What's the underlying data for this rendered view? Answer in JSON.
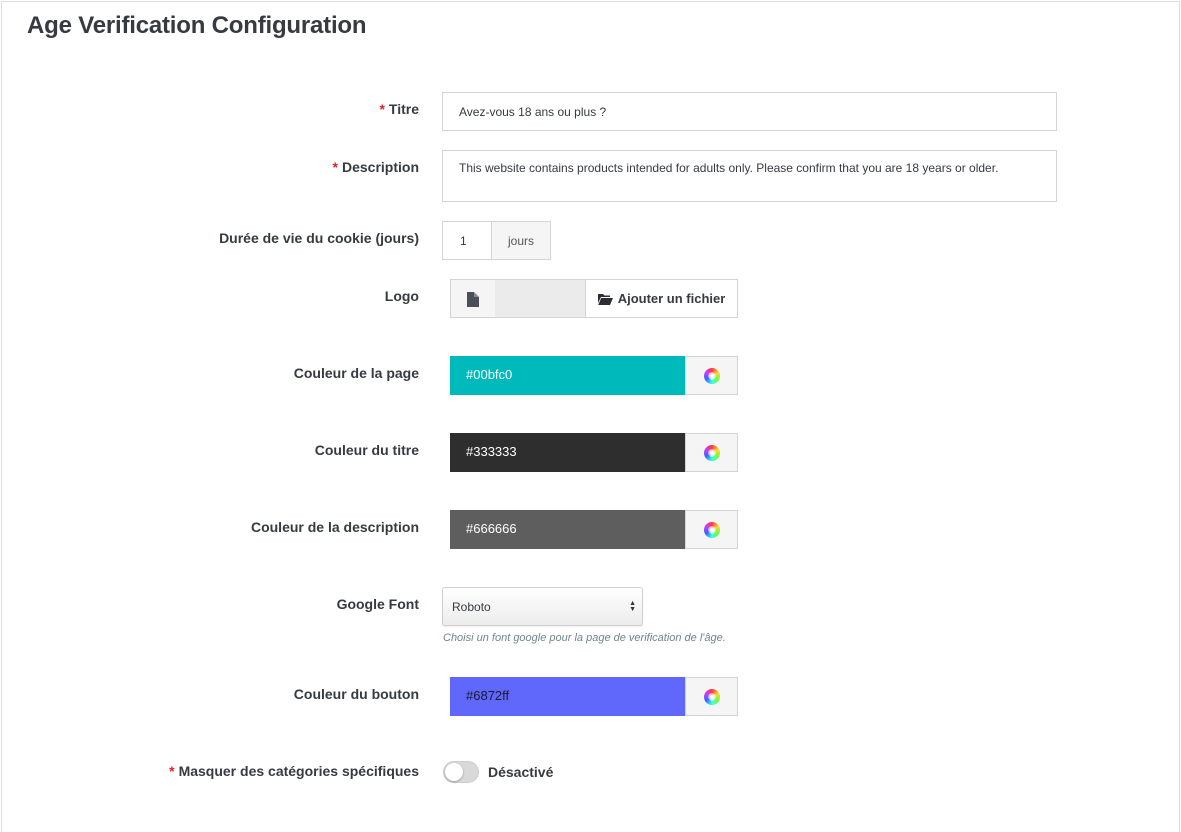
{
  "panel": {
    "title": "Age Verification Configuration"
  },
  "fields": {
    "titre": {
      "label": "Titre",
      "required": true,
      "value": "Avez-vous 18 ans ou plus ?"
    },
    "description": {
      "label": "Description",
      "required": true,
      "value": "This website contains products intended for adults only. Please confirm that you are 18 years or older."
    },
    "cookie": {
      "label": "Durée de vie du cookie (jours)",
      "value": "1",
      "suffix": "jours"
    },
    "logo": {
      "label": "Logo",
      "button_label": "Ajouter un fichier",
      "icon": "file-icon",
      "button_icon": "folder-open-icon"
    },
    "page_color": {
      "label": "Couleur de la page",
      "value": "#00bfc0",
      "swatch": "#00b9bb",
      "text_color": "#ffffff"
    },
    "title_color": {
      "label": "Couleur du titre",
      "value": "#333333",
      "swatch": "#2e2e2e",
      "text_color": "#ffffff"
    },
    "description_color": {
      "label": "Couleur de la description",
      "value": "#666666",
      "swatch": "#5e5e5e",
      "text_color": "#ffffff"
    },
    "google_font": {
      "label": "Google Font",
      "value": "Roboto",
      "help": "Choisi un font google pour la page de verification de l'âge."
    },
    "button_color": {
      "label": "Couleur du bouton",
      "value": "#6872ff",
      "swatch": "#6067fb",
      "text_color": "#1a1a33"
    },
    "hide_categories": {
      "label": "Masquer des catégories spécifiques",
      "required": true,
      "state": "Désactivé",
      "enabled": false
    }
  }
}
